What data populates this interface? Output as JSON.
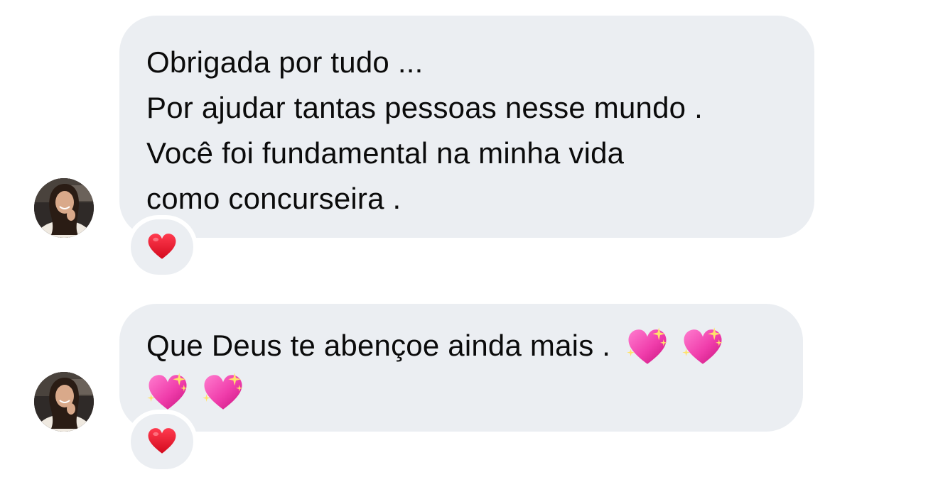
{
  "messages": [
    {
      "lines": [
        "Obrigada por tudo ...",
        "Por ajudar tantas pessoas nesse mundo .",
        "Você foi fundamental na minha vida",
        "como concurseira ."
      ],
      "reaction": "red-heart-icon"
    },
    {
      "text": "Que Deus te abençoe ainda mais .",
      "emojis": [
        "sparkling-heart-icon",
        "sparkling-heart-icon",
        "sparkling-heart-icon",
        "sparkling-heart-icon"
      ],
      "reaction": "red-heart-icon"
    }
  ],
  "colors": {
    "bubble": "#ebeef2",
    "text": "#0b0b0b",
    "heart": "#e0102a",
    "sparkling_heart": "#f03dab"
  }
}
